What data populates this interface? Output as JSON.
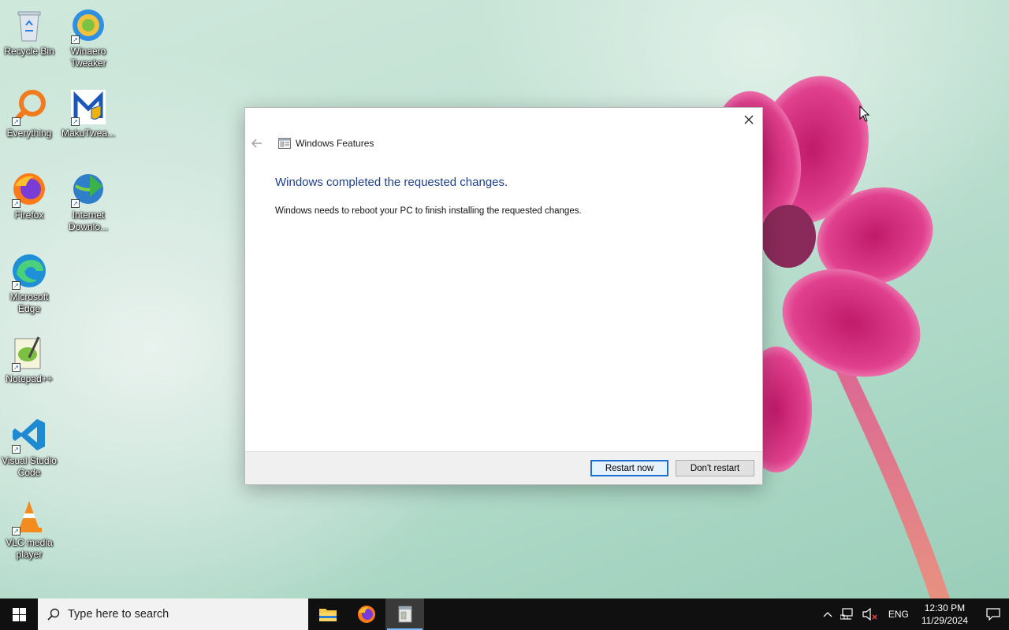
{
  "desktop": {
    "icons": [
      {
        "label": "Recycle Bin",
        "icon": "recycle-bin-icon"
      },
      {
        "label": "Winaero Tweaker",
        "icon": "winaero-tweaker-icon"
      },
      {
        "label": "Everything",
        "icon": "everything-search-icon"
      },
      {
        "label": "MakuTwea...",
        "icon": "makutweaker-icon"
      },
      {
        "label": "Firefox",
        "icon": "firefox-icon"
      },
      {
        "label": "Internet Downlo...",
        "icon": "internet-download-manager-icon"
      },
      {
        "label": "Microsoft Edge",
        "icon": "edge-icon"
      },
      {
        "label": "Notepad++",
        "icon": "notepadpp-icon"
      },
      {
        "label": "Visual Studio Code",
        "icon": "vscode-icon"
      },
      {
        "label": "VLC media player",
        "icon": "vlc-icon"
      }
    ]
  },
  "dialog": {
    "title": "Windows Features",
    "headline": "Windows completed the requested changes.",
    "message": "Windows needs to reboot your PC to finish installing the requested changes.",
    "restart_label": "Restart now",
    "dont_restart_label": "Don't restart"
  },
  "taskbar": {
    "search_placeholder": "Type here to search",
    "apps": [
      "file-explorer-icon",
      "firefox-icon",
      "windows-features-icon"
    ],
    "language": "ENG",
    "time": "12:30 PM",
    "date": "11/29/2024"
  },
  "colors": {
    "headline": "#1e3f8c",
    "taskbar": "#101010",
    "primary_button_border": "#1a6fd1"
  }
}
